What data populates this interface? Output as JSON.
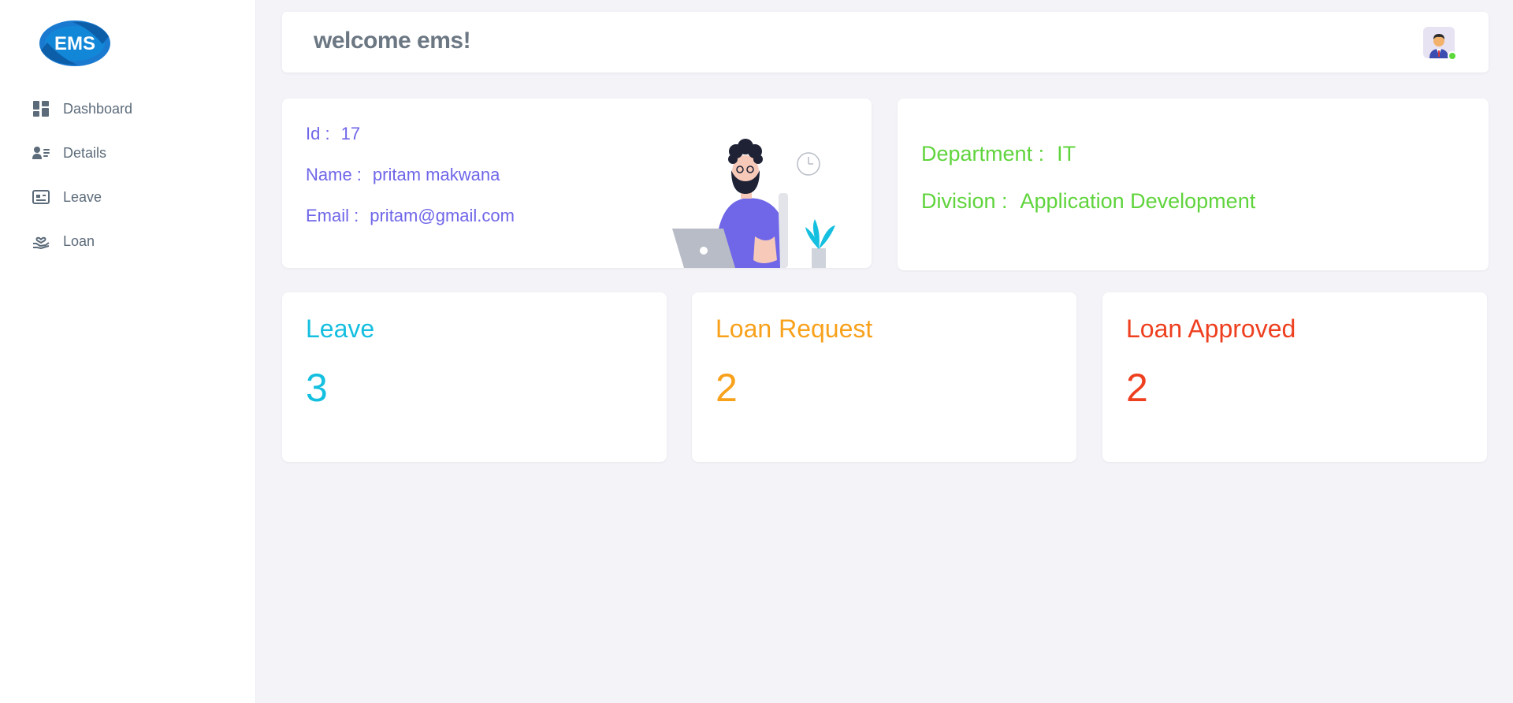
{
  "brand": {
    "logo_text": "EMS",
    "logo_color": "#1a7ad0"
  },
  "sidebar": {
    "items": [
      {
        "label": "Dashboard",
        "icon": "dashboard-icon"
      },
      {
        "label": "Details",
        "icon": "user-list-icon"
      },
      {
        "label": "Leave",
        "icon": "id-card-icon"
      },
      {
        "label": "Loan",
        "icon": "hand-heart-icon"
      }
    ]
  },
  "header": {
    "title": "welcome ems!",
    "avatar": "user-avatar",
    "status_color": "#5cd83a"
  },
  "profile": {
    "id_label": "Id :",
    "id_value": "17",
    "name_label": "Name :",
    "name_value": "pritam makwana",
    "email_label": "Email :",
    "email_value": "pritam@gmail.com",
    "color": "#6f66e8"
  },
  "org": {
    "department_label": "Department :",
    "department_value": "IT",
    "division_label": "Division :",
    "division_value": "Application Development",
    "color": "#5fd43c"
  },
  "stats": [
    {
      "title": "Leave",
      "value": "3",
      "color": "#15bfe0"
    },
    {
      "title": "Loan Request",
      "value": "2",
      "color": "#f8a11b"
    },
    {
      "title": "Loan Approved",
      "value": "2",
      "color": "#ee3f1f"
    }
  ]
}
